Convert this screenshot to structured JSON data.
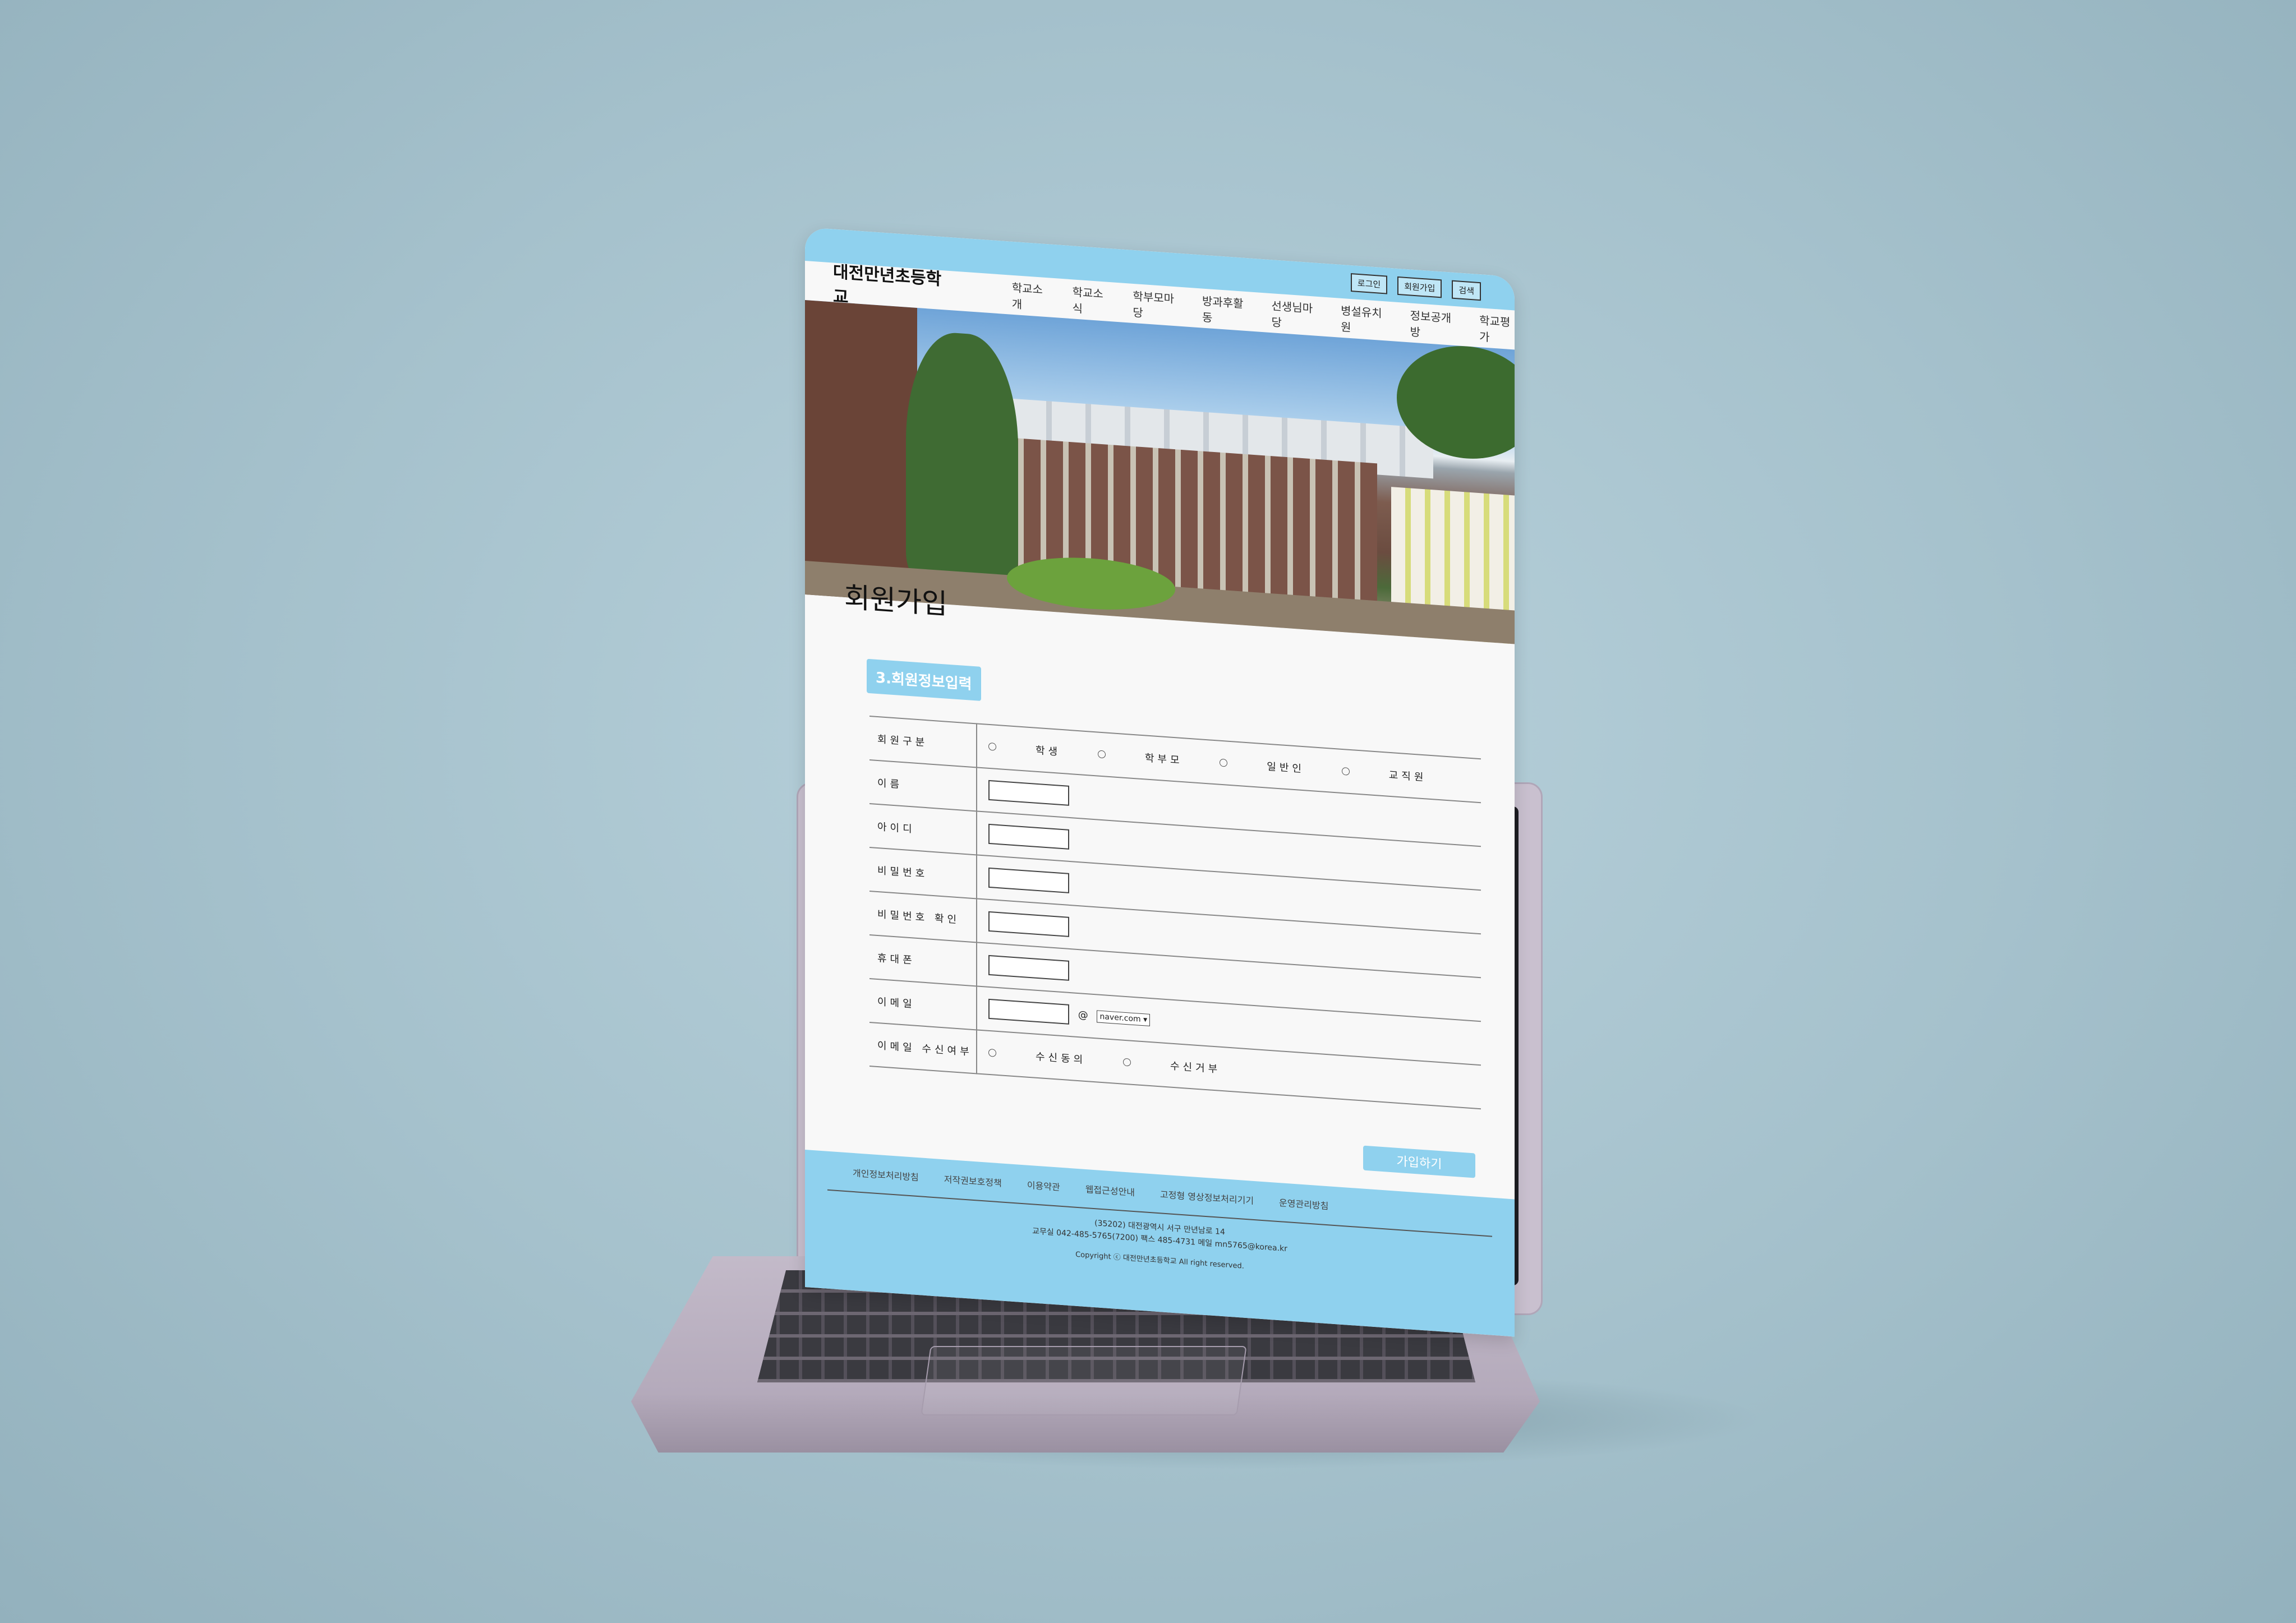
{
  "top_buttons": [
    "로그인",
    "회원가입",
    "검색"
  ],
  "site_title": "대전만년초등학교",
  "nav_items": [
    "학교소개",
    "학교소식",
    "학부모마당",
    "방과후활동",
    "선생님마당",
    "병설유치원",
    "정보공개방",
    "학교평가"
  ],
  "page_title": "회원가입",
  "step_label": "3.회원정보입력",
  "form": {
    "member_type_label": "회원구분",
    "member_type_options": [
      "학생",
      "학부모",
      "일반인",
      "교직원"
    ],
    "name_label": "이름",
    "id_label": "아이디",
    "password_label": "비밀번호",
    "password_confirm_label": "비밀번호 확인",
    "phone_label": "휴대폰",
    "email_label": "이메일",
    "email_at": "@",
    "email_domain": "naver.com",
    "email_receive_label": "이메일 수신여부",
    "email_receive_options": [
      "수신동의",
      "수신거부"
    ]
  },
  "submit_label": "가입하기",
  "footer": {
    "links": [
      "개인정보처리방침",
      "저작권보호정책",
      "이용약관",
      "웹접근성안내",
      "고정형 영상정보처리기기",
      "운영관리방침"
    ],
    "address_line1": "(35202) 대전광역시 서구 만년남로 14",
    "address_line2": "교무실 042-485-5765(7200) 팩스 485-4731 메일 mn5765@korea.kr",
    "copyright": "Copyright ⓒ 대전만년초등학교 All right reserved."
  }
}
